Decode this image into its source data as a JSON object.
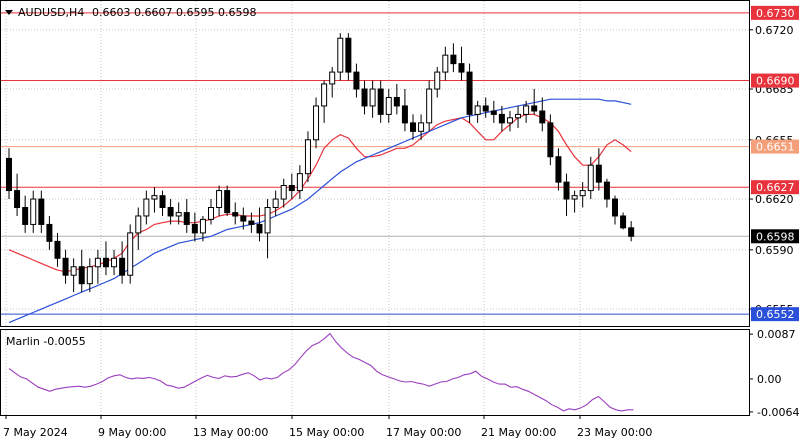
{
  "header": {
    "symbol": "AUDUSD,H4",
    "ohlc": "0.6603 0.6607 0.6595 0.6598"
  },
  "indicator": {
    "label": "Marlin -0.0055",
    "ticks": [
      "0.0087",
      "0.00",
      "-0.0064"
    ]
  },
  "colors": {
    "candle": "#000000",
    "grid": "#c8c8c8",
    "hline_red": "#e8323c",
    "hline_salmon": "#f4a07a",
    "hline_blue": "#2a4fd8",
    "ma_fast": "#e8323c",
    "ma_slow": "#2a4fd8",
    "marlin": "#9b3fbf",
    "price_marker": "#000000",
    "level_box_red": "#e8323c",
    "level_box_salmon": "#f4a07a",
    "level_box_blue": "#2a4fd8"
  },
  "chart_data": {
    "type": "candlestick",
    "ylim": [
      0.6545,
      0.6737
    ],
    "price_ticks": [
      "0.6720",
      "0.6685",
      "0.6655",
      "0.6620",
      "0.6590",
      "0.6555"
    ],
    "x_labels": [
      "7 May 2024",
      "9 May 00:00",
      "13 May 00:00",
      "15 May 00:00",
      "17 May 00:00",
      "21 May 00:00",
      "23 May 00:00"
    ],
    "current_price": "0.6598",
    "levels": [
      {
        "value": 0.673,
        "label": "0.6730",
        "style": "red"
      },
      {
        "value": 0.669,
        "label": "0.6690",
        "style": "red"
      },
      {
        "value": 0.6651,
        "label": "0.6651",
        "style": "salmon"
      },
      {
        "value": 0.6627,
        "label": "0.6627",
        "style": "red"
      },
      {
        "value": 0.6552,
        "label": "0.6552",
        "style": "blue"
      }
    ],
    "candles": [
      [
        0.6644,
        0.665,
        0.662,
        0.6625
      ],
      [
        0.6625,
        0.6635,
        0.661,
        0.6615
      ],
      [
        0.6615,
        0.6622,
        0.66,
        0.6605
      ],
      [
        0.6605,
        0.6625,
        0.66,
        0.662
      ],
      [
        0.662,
        0.6625,
        0.66,
        0.6605
      ],
      [
        0.6605,
        0.661,
        0.659,
        0.6595
      ],
      [
        0.6595,
        0.66,
        0.658,
        0.6585
      ],
      [
        0.6585,
        0.659,
        0.657,
        0.6575
      ],
      [
        0.6575,
        0.6585,
        0.6565,
        0.658
      ],
      [
        0.658,
        0.659,
        0.6565,
        0.657
      ],
      [
        0.657,
        0.6585,
        0.6565,
        0.658
      ],
      [
        0.658,
        0.659,
        0.657,
        0.6585
      ],
      [
        0.6585,
        0.6595,
        0.6575,
        0.658
      ],
      [
        0.658,
        0.659,
        0.6575,
        0.6585
      ],
      [
        0.6585,
        0.6595,
        0.657,
        0.6575
      ],
      [
        0.6575,
        0.6605,
        0.657,
        0.66
      ],
      [
        0.66,
        0.6615,
        0.659,
        0.661
      ],
      [
        0.661,
        0.6625,
        0.6605,
        0.662
      ],
      [
        0.662,
        0.6627,
        0.6612,
        0.6622
      ],
      [
        0.6622,
        0.6625,
        0.661,
        0.6615
      ],
      [
        0.6615,
        0.662,
        0.6605,
        0.661
      ],
      [
        0.661,
        0.6618,
        0.6605,
        0.6612
      ],
      [
        0.6612,
        0.662,
        0.66,
        0.6605
      ],
      [
        0.6605,
        0.6612,
        0.6595,
        0.66
      ],
      [
        0.66,
        0.661,
        0.6595,
        0.6608
      ],
      [
        0.6608,
        0.662,
        0.6605,
        0.6615
      ],
      [
        0.6615,
        0.6628,
        0.661,
        0.6625
      ],
      [
        0.6625,
        0.6628,
        0.661,
        0.6612
      ],
      [
        0.6612,
        0.6618,
        0.6605,
        0.661
      ],
      [
        0.661,
        0.6615,
        0.6602,
        0.6607
      ],
      [
        0.6607,
        0.6612,
        0.66,
        0.6605
      ],
      [
        0.6605,
        0.6615,
        0.6595,
        0.66
      ],
      [
        0.66,
        0.662,
        0.6585,
        0.6615
      ],
      [
        0.6615,
        0.6625,
        0.661,
        0.662
      ],
      [
        0.662,
        0.6632,
        0.6615,
        0.6628
      ],
      [
        0.6628,
        0.6635,
        0.662,
        0.6625
      ],
      [
        0.6625,
        0.664,
        0.662,
        0.6635
      ],
      [
        0.6635,
        0.666,
        0.663,
        0.6655
      ],
      [
        0.6655,
        0.668,
        0.665,
        0.6675
      ],
      [
        0.6675,
        0.669,
        0.6665,
        0.6688
      ],
      [
        0.6688,
        0.6698,
        0.668,
        0.6695
      ],
      [
        0.6695,
        0.6718,
        0.669,
        0.6715
      ],
      [
        0.6715,
        0.6718,
        0.669,
        0.6695
      ],
      [
        0.6695,
        0.67,
        0.668,
        0.6685
      ],
      [
        0.6685,
        0.669,
        0.667,
        0.6675
      ],
      [
        0.6675,
        0.669,
        0.6668,
        0.6685
      ],
      [
        0.6685,
        0.669,
        0.6665,
        0.667
      ],
      [
        0.667,
        0.6685,
        0.6665,
        0.668
      ],
      [
        0.668,
        0.6688,
        0.667,
        0.6675
      ],
      [
        0.6675,
        0.6685,
        0.666,
        0.6665
      ],
      [
        0.6665,
        0.667,
        0.6655,
        0.666
      ],
      [
        0.666,
        0.667,
        0.6655,
        0.6665
      ],
      [
        0.6665,
        0.669,
        0.666,
        0.6685
      ],
      [
        0.6685,
        0.6698,
        0.668,
        0.6695
      ],
      [
        0.6695,
        0.671,
        0.669,
        0.6705
      ],
      [
        0.6705,
        0.6712,
        0.6695,
        0.67
      ],
      [
        0.67,
        0.671,
        0.669,
        0.6695
      ],
      [
        0.6695,
        0.67,
        0.6665,
        0.667
      ],
      [
        0.667,
        0.6678,
        0.6665,
        0.6675
      ],
      [
        0.6675,
        0.668,
        0.6668,
        0.6672
      ],
      [
        0.6672,
        0.6678,
        0.6665,
        0.667
      ],
      [
        0.667,
        0.6675,
        0.666,
        0.6665
      ],
      [
        0.6665,
        0.6672,
        0.666,
        0.6668
      ],
      [
        0.6668,
        0.6675,
        0.6662,
        0.667
      ],
      [
        0.667,
        0.6678,
        0.6665,
        0.6675
      ],
      [
        0.6675,
        0.6685,
        0.667,
        0.6672
      ],
      [
        0.6672,
        0.668,
        0.666,
        0.6665
      ],
      [
        0.6665,
        0.667,
        0.664,
        0.6645
      ],
      [
        0.6645,
        0.665,
        0.6625,
        0.663
      ],
      [
        0.663,
        0.6635,
        0.661,
        0.662
      ],
      [
        0.662,
        0.6625,
        0.6612,
        0.6622
      ],
      [
        0.6622,
        0.663,
        0.6615,
        0.6625
      ],
      [
        0.6625,
        0.6645,
        0.662,
        0.664
      ],
      [
        0.664,
        0.665,
        0.6625,
        0.663
      ],
      [
        0.663,
        0.6632,
        0.6615,
        0.662
      ],
      [
        0.662,
        0.6622,
        0.6605,
        0.661
      ],
      [
        0.661,
        0.6612,
        0.6602,
        0.6603
      ],
      [
        0.6603,
        0.6607,
        0.6595,
        0.6598
      ]
    ],
    "ma_fast": [
      0.659,
      0.6588,
      0.6586,
      0.6584,
      0.6582,
      0.658,
      0.6578,
      0.6577,
      0.6578,
      0.6579,
      0.658,
      0.6581,
      0.6583,
      0.6585,
      0.6588,
      0.6595,
      0.66,
      0.6602,
      0.6605,
      0.6606,
      0.6607,
      0.6607,
      0.6606,
      0.6606,
      0.6607,
      0.6608,
      0.661,
      0.6611,
      0.6611,
      0.661,
      0.661,
      0.661,
      0.6611,
      0.6613,
      0.6616,
      0.662,
      0.6625,
      0.6632,
      0.664,
      0.665,
      0.6655,
      0.6658,
      0.6656,
      0.665,
      0.6645,
      0.6645,
      0.6646,
      0.6648,
      0.665,
      0.665,
      0.6652,
      0.6656,
      0.666,
      0.6664,
      0.6666,
      0.6667,
      0.6668,
      0.6665,
      0.666,
      0.6655,
      0.6655,
      0.666,
      0.6664,
      0.6668,
      0.667,
      0.667,
      0.6668,
      0.6665,
      0.666,
      0.6652,
      0.6645,
      0.664,
      0.664,
      0.6645,
      0.6652,
      0.6655,
      0.6652,
      0.6648
    ],
    "ma_slow": [
      0.6547,
      0.6549,
      0.6551,
      0.6553,
      0.6555,
      0.6557,
      0.6559,
      0.6561,
      0.6563,
      0.6565,
      0.6567,
      0.6569,
      0.6571,
      0.6573,
      0.6576,
      0.6579,
      0.6582,
      0.6585,
      0.6588,
      0.659,
      0.6592,
      0.6594,
      0.6595,
      0.6596,
      0.6597,
      0.6598,
      0.66,
      0.6602,
      0.6603,
      0.6604,
      0.6605,
      0.6606,
      0.6608,
      0.661,
      0.6612,
      0.6614,
      0.6617,
      0.662,
      0.6624,
      0.6628,
      0.6632,
      0.6636,
      0.6639,
      0.6642,
      0.6644,
      0.6646,
      0.6648,
      0.665,
      0.6652,
      0.6654,
      0.6656,
      0.6658,
      0.666,
      0.6662,
      0.6664,
      0.6666,
      0.6668,
      0.6669,
      0.667,
      0.6671,
      0.6672,
      0.6673,
      0.6674,
      0.6675,
      0.6676,
      0.6677,
      0.6678,
      0.6679,
      0.6679,
      0.6679,
      0.6679,
      0.6679,
      0.6679,
      0.6679,
      0.6678,
      0.6678,
      0.6677,
      0.6676
    ],
    "marlin_ylim": [
      -0.007,
      0.0095
    ],
    "marlin": [
      0.002,
      0.0012,
      0.0004,
      0.0,
      -0.0008,
      -0.0016,
      -0.002,
      -0.0024,
      -0.002,
      -0.0018,
      -0.0016,
      -0.0015,
      -0.0014,
      -0.0016,
      -0.0014,
      -0.001,
      -0.0005,
      0.0002,
      0.0006,
      0.0008,
      0.0003,
      0.0,
      0.0002,
      0.0001,
      0.0003,
      0.0,
      -0.0004,
      -0.0012,
      -0.0014,
      -0.0018,
      -0.0016,
      -0.001,
      -0.0004,
      0.0002,
      0.0007,
      0.0003,
      0.0001,
      0.0006,
      0.0004,
      0.0005,
      0.0009,
      0.0012,
      0.0006,
      -0.0002,
      0.0002,
      0.0,
      0.0003,
      0.0012,
      0.0018,
      0.0028,
      0.0042,
      0.0055,
      0.0065,
      0.007,
      0.0078,
      0.0088,
      0.0072,
      0.006,
      0.005,
      0.0042,
      0.0038,
      0.0032,
      0.0026,
      0.0015,
      0.0008,
      0.0004,
      0.0,
      -0.0004,
      -0.0006,
      -0.0005,
      -0.0008,
      -0.001,
      -0.0014,
      -0.001,
      -0.0006,
      -0.0005,
      0.0,
      0.0003,
      0.0008,
      0.001,
      0.0015,
      0.0005,
      0.0,
      -0.0006,
      -0.001,
      -0.001,
      -0.0016,
      -0.0015,
      -0.002,
      -0.0024,
      -0.003,
      -0.0036,
      -0.0042,
      -0.005,
      -0.0055,
      -0.0062,
      -0.0058,
      -0.006,
      -0.0056,
      -0.005,
      -0.004,
      -0.0034,
      -0.0044,
      -0.0055,
      -0.006,
      -0.0062,
      -0.006,
      -0.006
    ]
  }
}
